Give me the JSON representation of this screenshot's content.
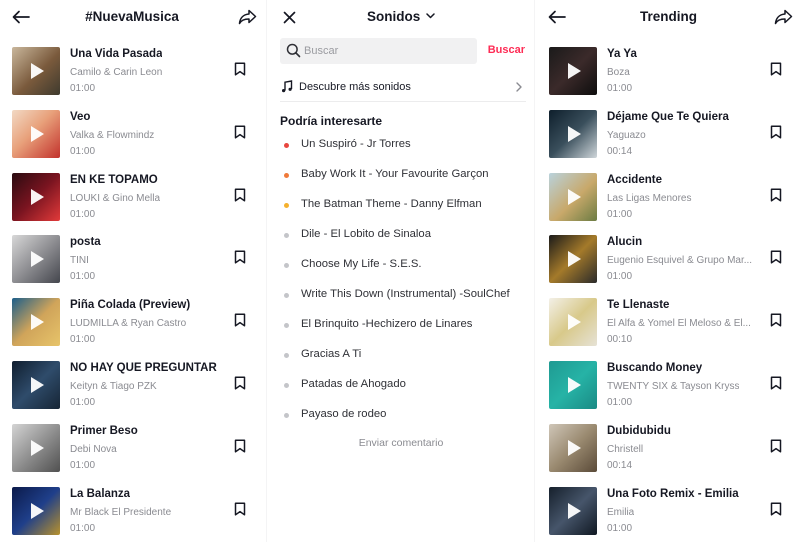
{
  "left_panel": {
    "title": "#NuevaMusica",
    "back_icon": "arrow-left-icon",
    "share_icon": "share-icon",
    "tracks": [
      {
        "title": "Una Vida Pasada",
        "artist": "Camilo & Carin Leon",
        "duration": "01:00"
      },
      {
        "title": "Veo",
        "artist": "Valka & Flowmindz",
        "duration": "01:00"
      },
      {
        "title": "EN KE TOPAMO",
        "artist": "LOUKI & Gino Mella",
        "duration": "01:00"
      },
      {
        "title": "posta",
        "artist": "TINI",
        "duration": "01:00"
      },
      {
        "title": "Piña Colada (Preview)",
        "artist": "LUDMILLA & Ryan Castro",
        "duration": "01:00"
      },
      {
        "title": "NO HAY QUE PREGUNTAR",
        "artist": "Keityn & Tiago PZK",
        "duration": "01:00"
      },
      {
        "title": "Primer Beso",
        "artist": "Debi Nova",
        "duration": "01:00"
      },
      {
        "title": "La Balanza",
        "artist": "Mr Black El Presidente",
        "duration": "01:00"
      }
    ]
  },
  "middle_panel": {
    "title": "Sonidos",
    "close_icon": "close-icon",
    "search": {
      "placeholder": "Buscar",
      "value": "",
      "button_label": "Buscar"
    },
    "discover_label": "Descubre más sonidos",
    "section_title": "Podría interesarte",
    "suggestions": [
      {
        "label": "Un Suspiró - Jr Torres",
        "dot_color": "#e8473f"
      },
      {
        "label": "Baby Work It - Your Favourite Garçon",
        "dot_color": "#f07a3a"
      },
      {
        "label": "The Batman Theme - Danny Elfman",
        "dot_color": "#f5b12e"
      },
      {
        "label": "Dile - El Lobito de Sinaloa",
        "dot_color": "#c4c5c9"
      },
      {
        "label": "Choose My Life - S.E.S.",
        "dot_color": "#c4c5c9"
      },
      {
        "label": "Write This Down (Instrumental) -SoulChef",
        "dot_color": "#c4c5c9"
      },
      {
        "label": "El Brinquito -Hechizero de Linares",
        "dot_color": "#c4c5c9"
      },
      {
        "label": "Gracias A Ti",
        "dot_color": "#c4c5c9"
      },
      {
        "label": "Patadas de Ahogado",
        "dot_color": "#c4c5c9"
      },
      {
        "label": "Payaso de rodeo",
        "dot_color": "#c4c5c9"
      }
    ],
    "feedback_label": "Enviar comentario"
  },
  "right_panel": {
    "title": "Trending",
    "tracks": [
      {
        "title": "Ya Ya",
        "artist": "Boza",
        "duration": "01:00"
      },
      {
        "title": "Déjame Que Te Quiera",
        "artist": "Yaguazo",
        "duration": "00:14"
      },
      {
        "title": "Accidente",
        "artist": "Las Ligas Menores",
        "duration": "01:00"
      },
      {
        "title": "Alucin",
        "artist": "Eugenio Esquivel & Grupo Mar...",
        "duration": "01:00"
      },
      {
        "title": "Te Llenaste",
        "artist": "El Alfa & Yomel El Meloso & El...",
        "duration": "00:10"
      },
      {
        "title": "Buscando Money",
        "artist": "TWENTY SIX & Tayson Kryss",
        "duration": "01:00"
      },
      {
        "title": "Dubidubidu",
        "artist": "Christell",
        "duration": "00:14"
      },
      {
        "title": "Una Foto Remix - Emilia",
        "artist": "Emilia",
        "duration": "01:00"
      }
    ]
  },
  "colors": {
    "accent": "#fe2c55",
    "text_primary": "#161823",
    "text_secondary": "#8a8b91"
  }
}
